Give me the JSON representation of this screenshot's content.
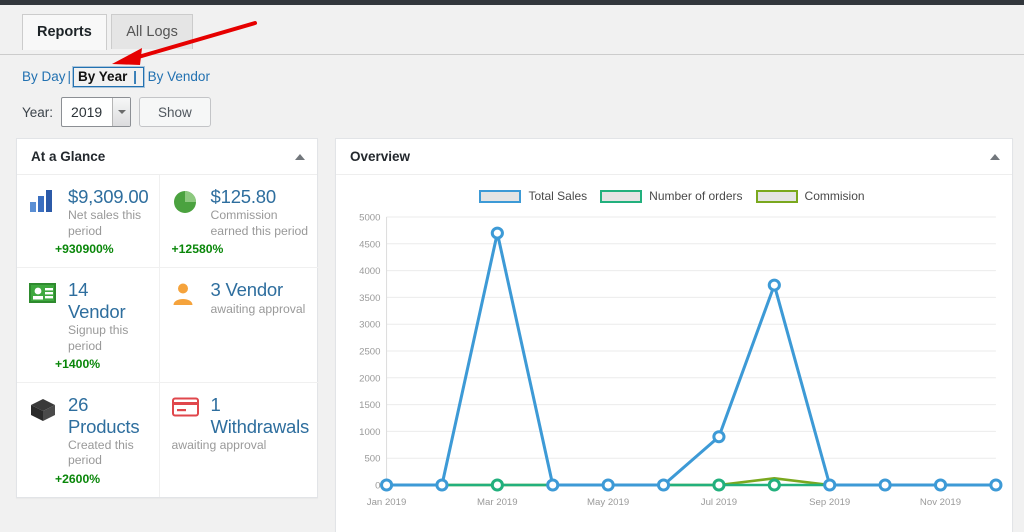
{
  "tabs": [
    {
      "label": "Reports",
      "active": true
    },
    {
      "label": "All Logs",
      "active": false
    }
  ],
  "subnav": {
    "by_day": "By Day",
    "separator": "|",
    "by_year": "By Year",
    "by_vendor": "By Vendor"
  },
  "filter": {
    "year_label": "Year:",
    "year_value": "2019",
    "show_label": "Show"
  },
  "glance": {
    "title": "At a Glance",
    "cells": [
      {
        "icon": "bar-chart-icon",
        "number": "$9,309.00",
        "desc": "Net sales this period",
        "pct": "+930900%",
        "pct_indent": true
      },
      {
        "icon": "pie-chart-icon",
        "number": "$125.80",
        "desc": "Commission earned this period",
        "pct": "+12580%",
        "pct_indent": false
      },
      {
        "icon": "id-card-icon",
        "number": "14 Vendor",
        "desc": "Signup this period",
        "pct": "+1400%",
        "pct_indent": true
      },
      {
        "icon": "user-icon",
        "number": "3 Vendor",
        "desc": "awaiting approval",
        "pct": "",
        "pct_indent": false
      },
      {
        "icon": "box-icon",
        "number": "26 Products",
        "desc": "Created this period",
        "pct": "+2600%",
        "pct_indent": true
      },
      {
        "icon": "credit-card-icon",
        "number": "1 Withdrawals",
        "desc": "awaiting approval",
        "pct": "",
        "pct_indent": false
      }
    ]
  },
  "overview": {
    "title": "Overview"
  },
  "colors": {
    "total_sales": "#3d9ad6",
    "number_of_orders": "#22b07d",
    "commision": "#7aa81e",
    "link": "#2271b1",
    "number": "#2e6e9e",
    "positive": "#0a870a",
    "annotation_arrow": "#e60000",
    "page_bg": "#f1f1f1",
    "admin_bar": "#32373c"
  },
  "chart_data": {
    "type": "line",
    "title": "Overview",
    "xlabel": "",
    "ylabel": "",
    "ylim": [
      0,
      5000
    ],
    "yticks": [
      0,
      500,
      1000,
      1500,
      2000,
      2500,
      3000,
      3500,
      4000,
      4500,
      5000
    ],
    "grid": true,
    "legend_position": "top-center",
    "x": [
      "Jan 2019",
      "Feb 2019",
      "Mar 2019",
      "Apr 2019",
      "May 2019",
      "Jun 2019",
      "Jul 2019",
      "Aug 2019",
      "Sep 2019",
      "Oct 2019",
      "Nov 2019",
      "Dec 2019"
    ],
    "xtick_labels": [
      "Jan 2019",
      "",
      "Mar 2019",
      "",
      "May 2019",
      "",
      "Jul 2019",
      "",
      "Sep 2019",
      "",
      "Nov 2019",
      ""
    ],
    "series": [
      {
        "name": "Total Sales",
        "color": "#3d9ad6",
        "values": [
          0,
          0,
          4700,
          0,
          0,
          0,
          900,
          3730,
          0,
          0,
          0,
          0
        ]
      },
      {
        "name": "Number of orders",
        "color": "#22b07d",
        "values": [
          0,
          0,
          0,
          0,
          0,
          0,
          0,
          0,
          0,
          0,
          0,
          0
        ]
      },
      {
        "name": "Commision",
        "color": "#7aa81e",
        "values": [
          0,
          0,
          0,
          0,
          0,
          0,
          0,
          125,
          0,
          0,
          0,
          0
        ]
      }
    ]
  }
}
